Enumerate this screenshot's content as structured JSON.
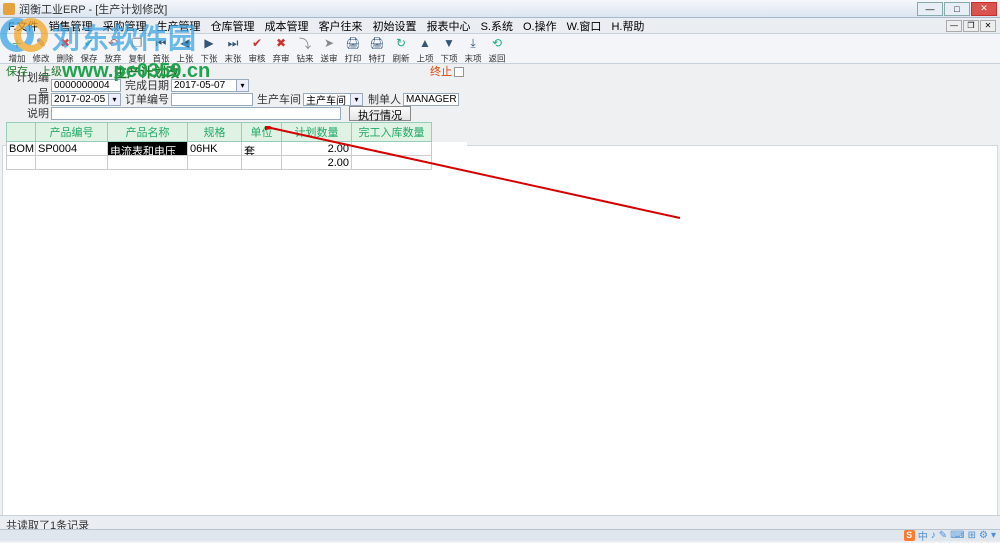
{
  "window": {
    "title": "润衡工业ERP - [生产计划修改]"
  },
  "menu": [
    "F.文件",
    "销售管理",
    "采购管理",
    "生产管理",
    "仓库管理",
    "成本管理",
    "客户往来",
    "初始设置",
    "报表中心",
    "S.系统",
    "O.操作",
    "W.窗口",
    "H.帮助"
  ],
  "toolbar": [
    {
      "label": "增加",
      "icon": "＋",
      "name": "add-button",
      "color": "#2a8"
    },
    {
      "label": "修改",
      "icon": "✎",
      "name": "edit-button",
      "color": "#46a"
    },
    {
      "label": "删除",
      "icon": "✖",
      "name": "delete-button",
      "color": "#d44"
    },
    {
      "label": "保存",
      "icon": "✔",
      "name": "save-button",
      "color": "#2a8"
    },
    {
      "label": "放弃",
      "icon": "↶",
      "name": "discard-button",
      "color": "#a66"
    },
    {
      "label": "复制",
      "icon": "❐",
      "name": "copy-button",
      "color": "#888"
    },
    {
      "label": "首张",
      "icon": "⏮",
      "name": "first-button",
      "color": "#357"
    },
    {
      "label": "上张",
      "icon": "◀",
      "name": "prev-button",
      "color": "#357"
    },
    {
      "label": "下张",
      "icon": "▶",
      "name": "next-button",
      "color": "#357"
    },
    {
      "label": "末张",
      "icon": "⏭",
      "name": "last-button",
      "color": "#357"
    },
    {
      "label": "审核",
      "icon": "✔",
      "name": "approve-button",
      "color": "#c33"
    },
    {
      "label": "弃审",
      "icon": "✖",
      "name": "unapprove-button",
      "color": "#c33"
    },
    {
      "label": "钻来",
      "icon": "⤵",
      "name": "drill-in-button",
      "color": "#888"
    },
    {
      "label": "送审",
      "icon": "➤",
      "name": "submit-button",
      "color": "#888"
    },
    {
      "label": "打印",
      "icon": "🖨",
      "name": "print-button",
      "color": "#357"
    },
    {
      "label": "特打",
      "icon": "🖨",
      "name": "special-print-button",
      "color": "#357"
    },
    {
      "label": "刷新",
      "icon": "↻",
      "name": "refresh-button",
      "color": "#2a8"
    },
    {
      "label": "上项",
      "icon": "▲",
      "name": "up-item-button",
      "color": "#357"
    },
    {
      "label": "下项",
      "icon": "▼",
      "name": "down-item-button",
      "color": "#357"
    },
    {
      "label": "末项",
      "icon": "⤓",
      "name": "last-item-button",
      "color": "#357"
    },
    {
      "label": "返回",
      "icon": "⟲",
      "name": "back-button",
      "color": "#2a8"
    }
  ],
  "formHeader": {
    "save": "保存",
    "give": "上级",
    "title": "生产计划改",
    "stop": "终止"
  },
  "fields": {
    "planNoLabel": "计划编号",
    "planNo": "0000000004",
    "finishDateLabel": "完成日期",
    "finishDate": "2017-05-07",
    "dateLabel": "日期",
    "date": "2017-02-05",
    "orderNoLabel": "订单编号",
    "orderNo": "",
    "workshopLabel": "生产车间",
    "workshop": "主产车间",
    "makerLabel": "制单人",
    "maker": "MANAGER",
    "descLabel": "说明",
    "desc": "",
    "execBtn": "执行情况"
  },
  "grid": {
    "cols": [
      "",
      "产品编号",
      "产品名称",
      "规格",
      "单位",
      "计划数量",
      "完工入库数量"
    ],
    "row": {
      "bom": "BOM表",
      "code": "SP0004",
      "name": "电流表和电压表",
      "spec": "06HK",
      "unit": "套",
      "planQty": "2.00",
      "doneQty": ""
    },
    "footPlanQty": "2.00"
  },
  "status": "共读取了1条记录",
  "watermark": {
    "text": "刘东软件园",
    "url": "www.pc0359.cn"
  },
  "tray": [
    "中",
    "♪",
    "✎",
    "⌨",
    "⊞",
    "⚙",
    "▾"
  ]
}
